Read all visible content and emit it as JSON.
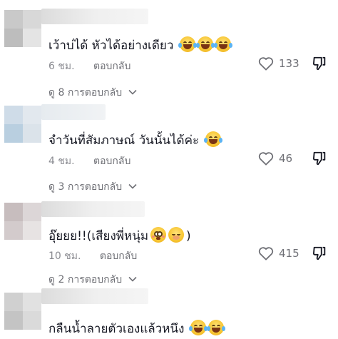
{
  "comments": [
    {
      "text": "เว้าบ่ได้ หัวได้อย่างเดียว",
      "emojis": [
        "face-with-tears-of-joy",
        "face-with-tears-of-joy",
        "face-with-tears-of-joy"
      ],
      "time": "6 ชม.",
      "reply": "ตอบกลับ",
      "likes": "133",
      "view_replies": "ดู 8 การตอบกลับ"
    },
    {
      "text": "จำวันที่สัมภาษณ์ วันนั้นได้ค่ะ",
      "emojis": [
        "face-with-tears-of-joy"
      ],
      "time": "4 ชม.",
      "reply": "ตอบกลับ",
      "likes": "46",
      "view_replies": "ดู 3 การตอบกลับ"
    },
    {
      "text": "อุ๊ยยย!!(เสียงพี่หนุ่ม",
      "text_suffix": ")",
      "emojis": [
        "flushed-face",
        "face-with-hand-over-mouth"
      ],
      "time": "10 ชม.",
      "reply": "ตอบกลับ",
      "likes": "415",
      "view_replies": "ดู 2 การตอบกลับ"
    },
    {
      "text": "กลืนน้ำลายตัวเองแล้วหนึง",
      "emojis": [
        "face-with-tears-of-joy",
        "face-with-tears-of-joy"
      ]
    }
  ],
  "colors": {
    "text_primary": "#161823",
    "text_secondary": "#8a8b91",
    "icon": "#6f7076",
    "background": "#ffffff"
  }
}
